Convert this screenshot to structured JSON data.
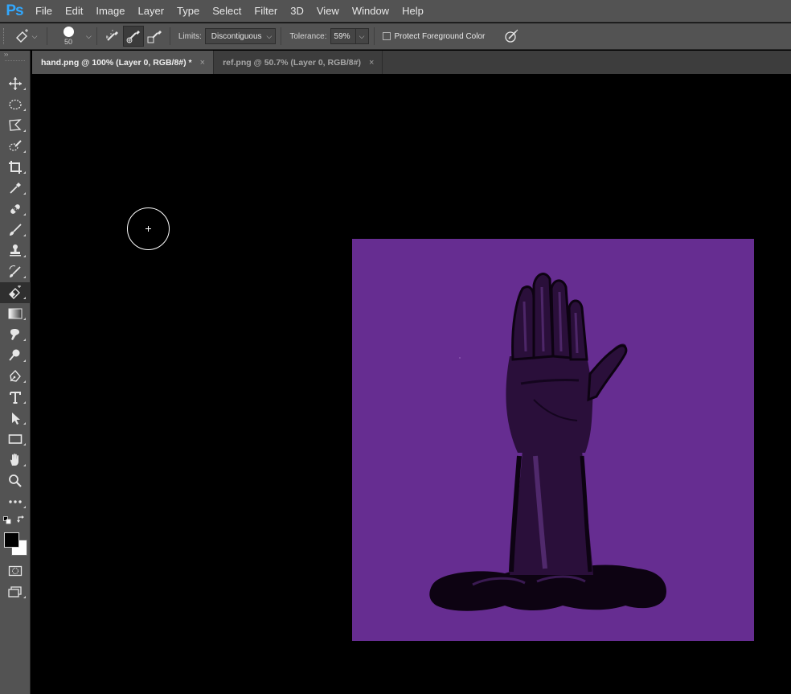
{
  "app": {
    "logo": "Ps",
    "accent_color": "#31a8ff"
  },
  "menu": [
    "File",
    "Edit",
    "Image",
    "Layer",
    "Type",
    "Select",
    "Filter",
    "3D",
    "View",
    "Window",
    "Help"
  ],
  "options": {
    "tool_icon": "background-eraser-icon",
    "brush_size": "50",
    "sampling_modes": [
      "sampling-continuous-icon",
      "sampling-once-icon",
      "sampling-background-swatch-icon"
    ],
    "active_sampling": 1,
    "limits_label": "Limits:",
    "limits_value": "Discontiguous",
    "tolerance_label": "Tolerance:",
    "tolerance_value": "59%",
    "protect_label": "Protect Foreground Color",
    "protect_checked": false,
    "pressure_icon": "pressure-tolerance-icon"
  },
  "tabs": [
    {
      "label": "hand.png @ 100% (Layer 0, RGB/8#) *",
      "active": true,
      "close": "×"
    },
    {
      "label": "ref.png @ 50.7% (Layer 0, RGB/8#)",
      "active": false,
      "close": "×"
    }
  ],
  "toolbar": {
    "collapse": "››",
    "tools": [
      "move",
      "elliptical-marquee",
      "polygonal-lasso",
      "quick-selection",
      "crop",
      "eyedropper",
      "healing-brush",
      "brush",
      "clone-stamp",
      "history-brush",
      "background-eraser",
      "gradient",
      "smudge",
      "dodge",
      "pen",
      "type",
      "path-selection",
      "rectangle",
      "hand",
      "zoom",
      "more"
    ],
    "active_tool": "background-eraser",
    "foreground_color": "#000000",
    "background_color": "#ffffff"
  },
  "canvas": {
    "background_color": "#000000",
    "image_fill": "#662d91",
    "image_subject": "hand"
  }
}
